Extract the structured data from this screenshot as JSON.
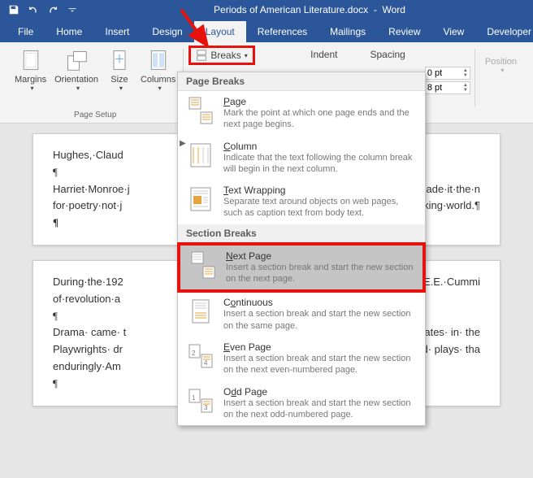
{
  "titlebar": {
    "document_name": "Periods of American Literature.docx",
    "app": "Word"
  },
  "menu": {
    "file": "File",
    "home": "Home",
    "insert": "Insert",
    "design": "Design",
    "layout": "Layout",
    "references": "References",
    "mailings": "Mailings",
    "review": "Review",
    "view": "View",
    "developer": "Developer"
  },
  "ribbon": {
    "margins": "Margins",
    "orientation": "Orientation",
    "size": "Size",
    "columns": "Columns",
    "page_setup": "Page Setup",
    "breaks": "Breaks",
    "indent": "Indent",
    "spacing": "Spacing",
    "before": "0 pt",
    "after": "8 pt",
    "position": "Position"
  },
  "dropdown": {
    "page_breaks_header": "Page Breaks",
    "section_breaks_header": "Section Breaks",
    "page": {
      "title_pre": "",
      "title_u": "P",
      "title_post": "age",
      "desc": "Mark the point at which one page ends and the next page begins."
    },
    "column": {
      "title_pre": "",
      "title_u": "C",
      "title_post": "olumn",
      "desc": "Indicate that the text following the column break will begin in the next column."
    },
    "text_wrapping": {
      "title_pre": "",
      "title_u": "T",
      "title_post": "ext Wrapping",
      "desc": "Separate text around objects on web pages, such as caption text from body text."
    },
    "next_page": {
      "title_pre": "",
      "title_u": "N",
      "title_post": "ext Page",
      "desc": "Insert a section break and start the new section on the next page."
    },
    "continuous": {
      "title_pre": "C",
      "title_u": "o",
      "title_post": "ntinuous",
      "desc": "Insert a section break and start the new section on the same page."
    },
    "even_page": {
      "title_pre": "",
      "title_u": "E",
      "title_post": "ven Page",
      "desc": "Insert a section break and start the new section on the next even-numbered page."
    },
    "odd_page": {
      "title_pre": "O",
      "title_u": "d",
      "title_post": "d Page",
      "desc": "Insert a section break and start the new section on the next odd-numbered page."
    }
  },
  "document": {
    "line1": "Hughes,·Claud",
    "para": "¶",
    "line2a": "Harriet·Monroe·j",
    "line2b": "012·and·made·it·the·n",
    "line3a": "for·poetry·not·j",
    "line3b": "-speaking·world.¶",
    "line4a": "During·the·192",
    "line4b": "re,·and·E.E.·Cummi",
    "line5": "of·revolution·a",
    "line6a": "Drama· came· t",
    "line6b": "United· States· in· the",
    "line7a": "Playwrights· dr",
    "line7b": "ut· created· plays· tha",
    "line8": "enduringly·Am"
  }
}
